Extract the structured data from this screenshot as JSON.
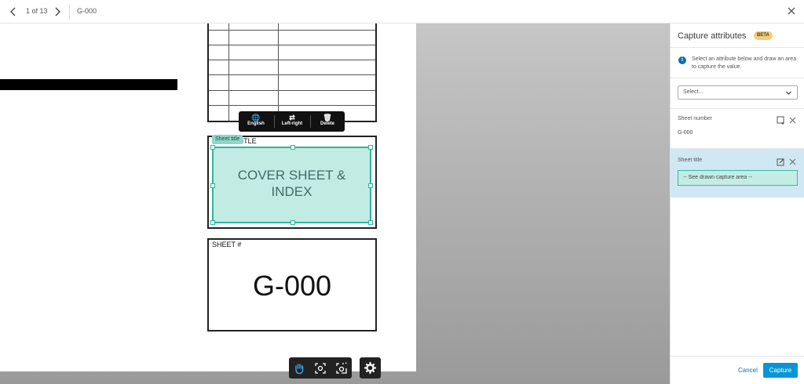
{
  "topbar": {
    "counter": "1 of 13",
    "sheet_name": "G-000"
  },
  "drawing": {
    "sheet_title_label": "SHEET TITLE",
    "sheet_title_text": "COVER SHEET & INDEX",
    "sheet_number_label": "SHEET #",
    "sheet_number": "G-000",
    "capture_tag": "Sheet title"
  },
  "popup": {
    "language": "English",
    "direction": "Left-right",
    "delete": "Delete"
  },
  "panel": {
    "title": "Capture attributes",
    "badge": "BETA",
    "info": "Select an attribute below and draw an area to capture the value.",
    "select_placeholder": "Select...",
    "sheet_number_label": "Sheet number",
    "sheet_number_value": "G-000",
    "sheet_title_label": "Sheet title",
    "sheet_title_value": "-- See drawn capture area --",
    "cancel": "Cancel",
    "capture": "Capture"
  },
  "colors": {
    "accent": "#0696d7",
    "capture_fill": "#c4ece4",
    "capture_border": "#2fb59d",
    "badge": "#f6cd7a"
  }
}
